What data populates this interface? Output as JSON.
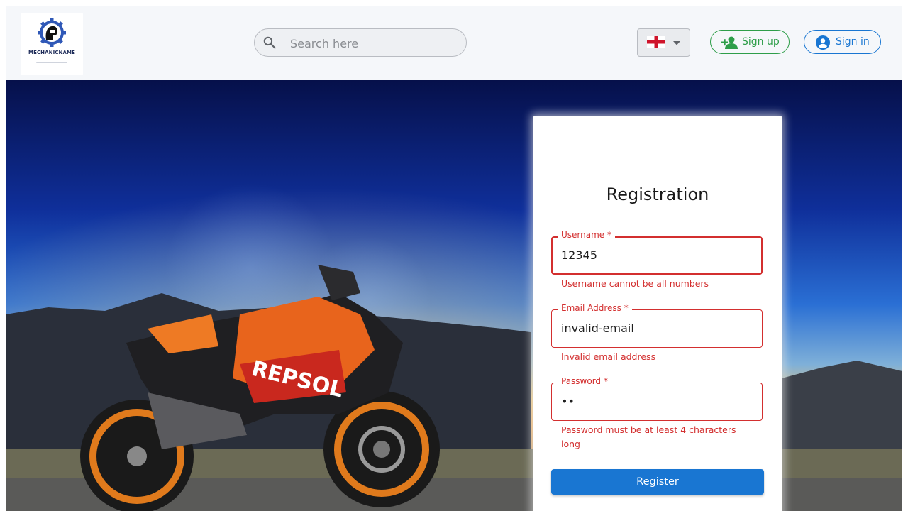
{
  "header": {
    "logo_text": "MECHANICNAME",
    "search": {
      "placeholder": "Search here",
      "value": ""
    },
    "language": {
      "selected": "England flag"
    },
    "signup_label": "Sign up",
    "signin_label": "Sign in"
  },
  "registration": {
    "title": "Registration",
    "fields": [
      {
        "label": "Username",
        "required": "*",
        "value": "12345",
        "error": "Username cannot be all numbers"
      },
      {
        "label": "Email Address",
        "required": "*",
        "value": "invalid-email",
        "error": "Invalid email address"
      },
      {
        "label": "Password",
        "required": "*",
        "value": "••",
        "error": "Password must be at least 4 characters long"
      }
    ],
    "submit_label": "Register"
  },
  "colors": {
    "error": "#d32f2f",
    "primary": "#1976d2",
    "success": "#2e9e49",
    "header_bg": "#f5f7fa"
  },
  "icons": {
    "search": "search-icon",
    "flag": "england-flag-icon",
    "dropdown": "caret-down-icon",
    "signup": "person-add-icon",
    "signin": "account-circle-icon"
  }
}
